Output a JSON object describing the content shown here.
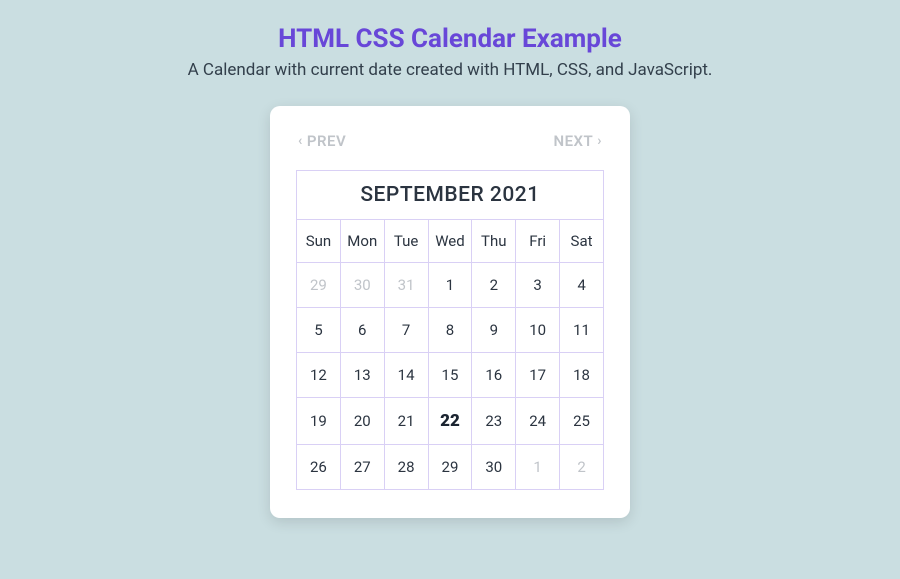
{
  "header": {
    "title": "HTML CSS Calendar Example",
    "subtitle": "A Calendar with current date created with HTML, CSS, and JavaScript."
  },
  "nav": {
    "prev_label": "PREV",
    "next_label": "NEXT"
  },
  "calendar": {
    "month_label": "SEPTEMBER 2021",
    "days_of_week": [
      "Sun",
      "Mon",
      "Tue",
      "Wed",
      "Thu",
      "Fri",
      "Sat"
    ],
    "weeks": [
      [
        {
          "d": "29",
          "muted": true
        },
        {
          "d": "30",
          "muted": true
        },
        {
          "d": "31",
          "muted": true
        },
        {
          "d": "1"
        },
        {
          "d": "2"
        },
        {
          "d": "3"
        },
        {
          "d": "4"
        }
      ],
      [
        {
          "d": "5"
        },
        {
          "d": "6"
        },
        {
          "d": "7"
        },
        {
          "d": "8"
        },
        {
          "d": "9"
        },
        {
          "d": "10"
        },
        {
          "d": "11"
        }
      ],
      [
        {
          "d": "12"
        },
        {
          "d": "13"
        },
        {
          "d": "14"
        },
        {
          "d": "15"
        },
        {
          "d": "16"
        },
        {
          "d": "17"
        },
        {
          "d": "18"
        }
      ],
      [
        {
          "d": "19"
        },
        {
          "d": "20"
        },
        {
          "d": "21"
        },
        {
          "d": "22",
          "today": true
        },
        {
          "d": "23"
        },
        {
          "d": "24"
        },
        {
          "d": "25"
        }
      ],
      [
        {
          "d": "26"
        },
        {
          "d": "27"
        },
        {
          "d": "28"
        },
        {
          "d": "29"
        },
        {
          "d": "30"
        },
        {
          "d": "1",
          "muted": true
        },
        {
          "d": "2",
          "muted": true
        }
      ]
    ]
  }
}
